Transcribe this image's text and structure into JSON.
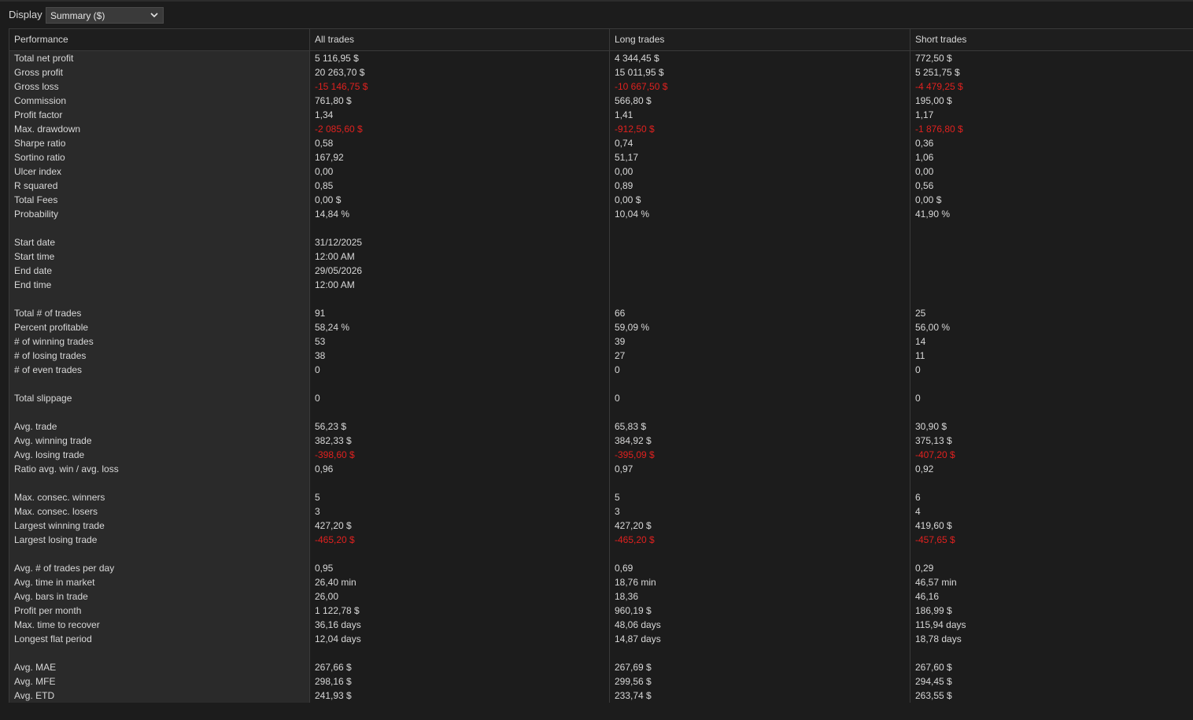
{
  "toolbar": {
    "display_label": "Display",
    "display_value": "Summary ($)"
  },
  "columns": {
    "label": "Performance",
    "all": "All trades",
    "long": "Long trades",
    "short": "Short trades"
  },
  "colors": {
    "negative": "#e0211f",
    "label_column_bg": "#2a2a2a",
    "background": "#1c1c1c"
  },
  "rows": [
    {
      "label": "Total net profit",
      "all": "5 116,95 $",
      "long": "4 344,45 $",
      "short": "772,50 $"
    },
    {
      "label": "Gross profit",
      "all": "20 263,70 $",
      "long": "15 011,95 $",
      "short": "5 251,75 $"
    },
    {
      "label": "Gross loss",
      "all": "-15 146,75 $",
      "long": "-10 667,50 $",
      "short": "-4 479,25 $",
      "negative": true
    },
    {
      "label": "Commission",
      "all": "761,80 $",
      "long": "566,80 $",
      "short": "195,00 $"
    },
    {
      "label": "Profit factor",
      "all": "1,34",
      "long": "1,41",
      "short": "1,17"
    },
    {
      "label": "Max. drawdown",
      "all": "-2 085,60 $",
      "long": "-912,50 $",
      "short": "-1 876,80 $",
      "negative": true
    },
    {
      "label": "Sharpe ratio",
      "all": "0,58",
      "long": "0,74",
      "short": "0,36"
    },
    {
      "label": "Sortino ratio",
      "all": "167,92",
      "long": "51,17",
      "short": "1,06"
    },
    {
      "label": "Ulcer index",
      "all": "0,00",
      "long": "0,00",
      "short": "0,00"
    },
    {
      "label": "R squared",
      "all": "0,85",
      "long": "0,89",
      "short": "0,56"
    },
    {
      "label": "Total Fees",
      "all": "0,00 $",
      "long": "0,00 $",
      "short": "0,00 $"
    },
    {
      "label": "Probability",
      "all": "14,84 %",
      "long": "10,04 %",
      "short": "41,90 %"
    },
    {
      "label": "",
      "all": "",
      "long": "",
      "short": ""
    },
    {
      "label": "Start date",
      "all": "31/12/2025",
      "long": "",
      "short": ""
    },
    {
      "label": "Start time",
      "all": "12:00 AM",
      "long": "",
      "short": ""
    },
    {
      "label": "End date",
      "all": "29/05/2026",
      "long": "",
      "short": ""
    },
    {
      "label": "End time",
      "all": "12:00 AM",
      "long": "",
      "short": ""
    },
    {
      "label": "",
      "all": "",
      "long": "",
      "short": ""
    },
    {
      "label": "Total # of trades",
      "all": "91",
      "long": "66",
      "short": "25"
    },
    {
      "label": "Percent profitable",
      "all": "58,24 %",
      "long": "59,09 %",
      "short": "56,00 %"
    },
    {
      "label": "# of winning trades",
      "all": "53",
      "long": "39",
      "short": "14"
    },
    {
      "label": "# of losing trades",
      "all": "38",
      "long": "27",
      "short": "11"
    },
    {
      "label": "# of even trades",
      "all": "0",
      "long": "0",
      "short": "0"
    },
    {
      "label": "",
      "all": "",
      "long": "",
      "short": ""
    },
    {
      "label": "Total slippage",
      "all": "0",
      "long": "0",
      "short": "0"
    },
    {
      "label": "",
      "all": "",
      "long": "",
      "short": ""
    },
    {
      "label": "Avg. trade",
      "all": "56,23 $",
      "long": "65,83 $",
      "short": "30,90 $"
    },
    {
      "label": "Avg. winning trade",
      "all": "382,33 $",
      "long": "384,92 $",
      "short": "375,13 $"
    },
    {
      "label": "Avg. losing trade",
      "all": "-398,60 $",
      "long": "-395,09 $",
      "short": "-407,20 $",
      "negative": true
    },
    {
      "label": "Ratio avg. win / avg. loss",
      "all": "0,96",
      "long": "0,97",
      "short": "0,92"
    },
    {
      "label": "",
      "all": "",
      "long": "",
      "short": ""
    },
    {
      "label": "Max. consec. winners",
      "all": "5",
      "long": "5",
      "short": "6"
    },
    {
      "label": "Max. consec. losers",
      "all": "3",
      "long": "3",
      "short": "4"
    },
    {
      "label": "Largest winning trade",
      "all": "427,20 $",
      "long": "427,20 $",
      "short": "419,60 $"
    },
    {
      "label": "Largest losing trade",
      "all": "-465,20 $",
      "long": "-465,20 $",
      "short": "-457,65 $",
      "negative": true
    },
    {
      "label": "",
      "all": "",
      "long": "",
      "short": ""
    },
    {
      "label": "Avg. # of trades per day",
      "all": "0,95",
      "long": "0,69",
      "short": "0,29"
    },
    {
      "label": "Avg. time in market",
      "all": "26,40 min",
      "long": "18,76 min",
      "short": "46,57 min"
    },
    {
      "label": "Avg. bars in trade",
      "all": "26,00",
      "long": "18,36",
      "short": "46,16"
    },
    {
      "label": "Profit per month",
      "all": "1 122,78 $",
      "long": "960,19 $",
      "short": "186,99 $"
    },
    {
      "label": "Max. time to recover",
      "all": "36,16 days",
      "long": "48,06 days",
      "short": "115,94 days"
    },
    {
      "label": "Longest flat period",
      "all": "12,04 days",
      "long": "14,87 days",
      "short": "18,78 days"
    },
    {
      "label": "",
      "all": "",
      "long": "",
      "short": ""
    },
    {
      "label": "Avg. MAE",
      "all": "267,66 $",
      "long": "267,69 $",
      "short": "267,60 $"
    },
    {
      "label": "Avg. MFE",
      "all": "298,16 $",
      "long": "299,56 $",
      "short": "294,45 $"
    },
    {
      "label": "Avg. ETD",
      "all": "241,93 $",
      "long": "233,74 $",
      "short": "263,55 $"
    }
  ]
}
